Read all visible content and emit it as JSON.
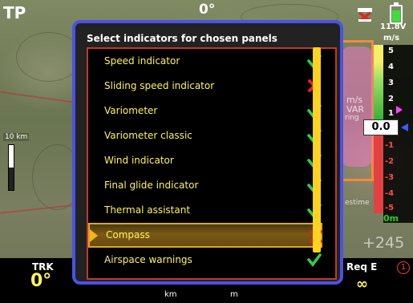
{
  "map": {
    "top_left_label": "TP",
    "heading_top": "0°",
    "scale_label": "10 km",
    "bg_ms_label": "m/s",
    "bg_var_label": "VAR",
    "bg_goring_label": "ring",
    "bg_estime_label": "estime",
    "alt_readout": "+245",
    "vario_label_0": "0.0"
  },
  "status": {
    "battery_voltage": "11.8V",
    "battery_color": "#3cde3c",
    "vario_unit": "m/s",
    "vario_ticks": [
      "5",
      "4",
      "3",
      "2",
      "1",
      "-1",
      "-2",
      "-3",
      "-4",
      "-5"
    ],
    "vario_zero": "0m"
  },
  "bottom": {
    "trk_label": "TRK",
    "trk_value": "0°",
    "km_unit": "km",
    "m_unit": "m",
    "req_label": "Req E",
    "req_value": "∞",
    "circle_num": "1"
  },
  "dialog": {
    "title": "Select indicators for chosen panels",
    "items": [
      {
        "label": "Speed indicator",
        "state": "check"
      },
      {
        "label": "Sliding speed indicator",
        "state": "cross"
      },
      {
        "label": "Variometer",
        "state": "check"
      },
      {
        "label": "Variometer classic",
        "state": "check"
      },
      {
        "label": "Wind indicator",
        "state": "check"
      },
      {
        "label": "Final glide indicator",
        "state": "check"
      },
      {
        "label": "Thermal assistant",
        "state": "check"
      },
      {
        "label": "Compass",
        "state": "cross",
        "selected": true
      },
      {
        "label": "Airspace warnings",
        "state": "check"
      }
    ],
    "colors": {
      "check": "#2fd04a",
      "cross": "#e02424",
      "border": "#4a52e6",
      "accent": "#ffd21f"
    }
  }
}
